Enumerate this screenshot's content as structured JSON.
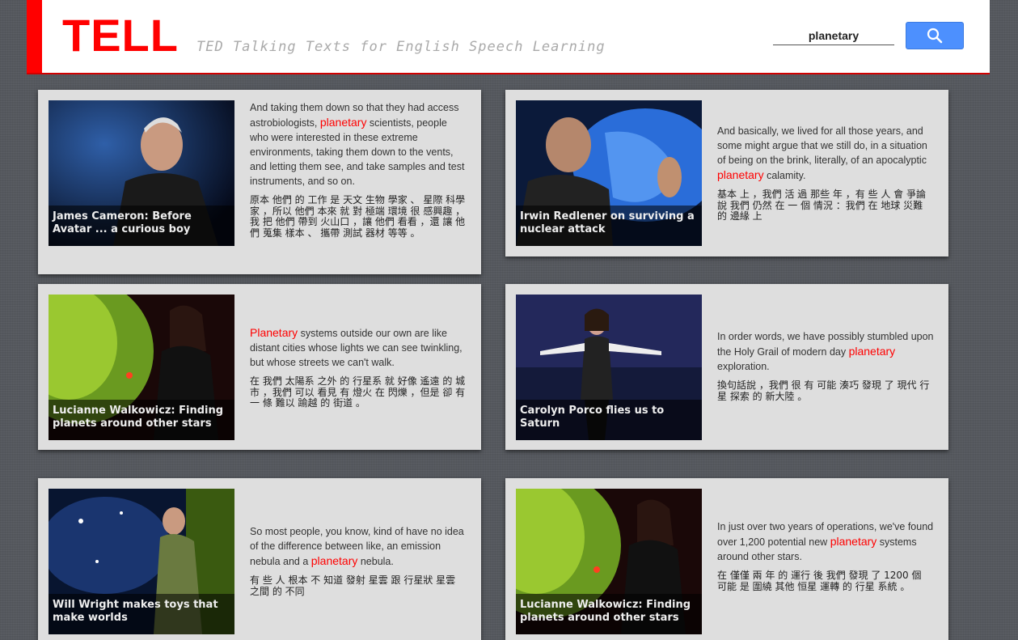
{
  "header": {
    "logo": "TELL",
    "tagline": "TED Talking Texts for English Speech Learning",
    "search_value": "planetary"
  },
  "results": [
    {
      "caption": "James Cameron: Before Avatar ... a curious boy",
      "en_before": "And taking them down so that they had access astrobiologists, ",
      "keyword": "planetary",
      "en_after": " scientists, people who were interested in these extreme environments, taking them down to the vents, and letting them see, and take samples and test instruments, and so on.",
      "zh": "原本 他們 的 工作 是 天文 生物 學家 、 星際 科學家 ，所以 他們 本來 就 對 極端 環境 很 感興趣 ，我 把 他們 帶到 火山口 ，讓 他們 看看 ，還 讓 他們 蒐集 樣本 、 攜帶 測試 器材 等等 。"
    },
    {
      "caption": "Irwin Redlener on surviving a nuclear attack",
      "en_before": "And basically, we lived for all those years, and some might argue that we still do, in a situation of being on the brink, literally, of an apocalyptic ",
      "keyword": "planetary",
      "en_after": " calamity.",
      "zh": "基本 上 ，我們 活 過 那些 年 ，有 些 人 會 爭論 說 我們 仍然 在 一 個 情況 ：我們 在 地球 災難 的 邊緣 上"
    },
    {
      "caption": "Lucianne Walkowicz: Finding planets around other stars",
      "en_before": "",
      "keyword": "Planetary",
      "en_after": " systems outside our own are like distant cities whose lights we can see twinkling, but whose streets we can't walk.",
      "zh": "在 我們 太陽系 之外 的 行星系 就 好像 遙遠 的 城市 ，我們 可以 看見 有 燈火 在 閃爍 ，但是 卻 有 一 條 難以 踰越 的 街道 。"
    },
    {
      "caption": "Carolyn Porco flies us to Saturn",
      "en_before": "In order words, we have possibly stumbled upon the Holy Grail of modern day ",
      "keyword": "planetary",
      "en_after": " exploration.",
      "zh": "換句話說 ，我們 很 有 可能 湊巧 發現 了 現代 行星 探索 的 新大陸 。"
    },
    {
      "caption": "Will Wright makes toys that make worlds",
      "en_before": "So most people, you know, kind of have no idea of the difference between like, an emission nebula and a ",
      "keyword": "planetary",
      "en_after": " nebula.",
      "zh": "有 些 人 根本 不 知道 發射 星雲 跟 行星狀 星雲 之間 的 不同"
    },
    {
      "caption": "Lucianne Walkowicz: Finding planets around other stars",
      "en_before": "In just over two years of operations, we've found over 1,200 potential new ",
      "keyword": "planetary",
      "en_after": " systems around other stars.",
      "zh": "在 僅僅 兩 年 的 運行 後 我們 發現 了 1200 個 可能 是 圍繞 其他 恒星 運轉 的 行星 系統 。"
    }
  ]
}
